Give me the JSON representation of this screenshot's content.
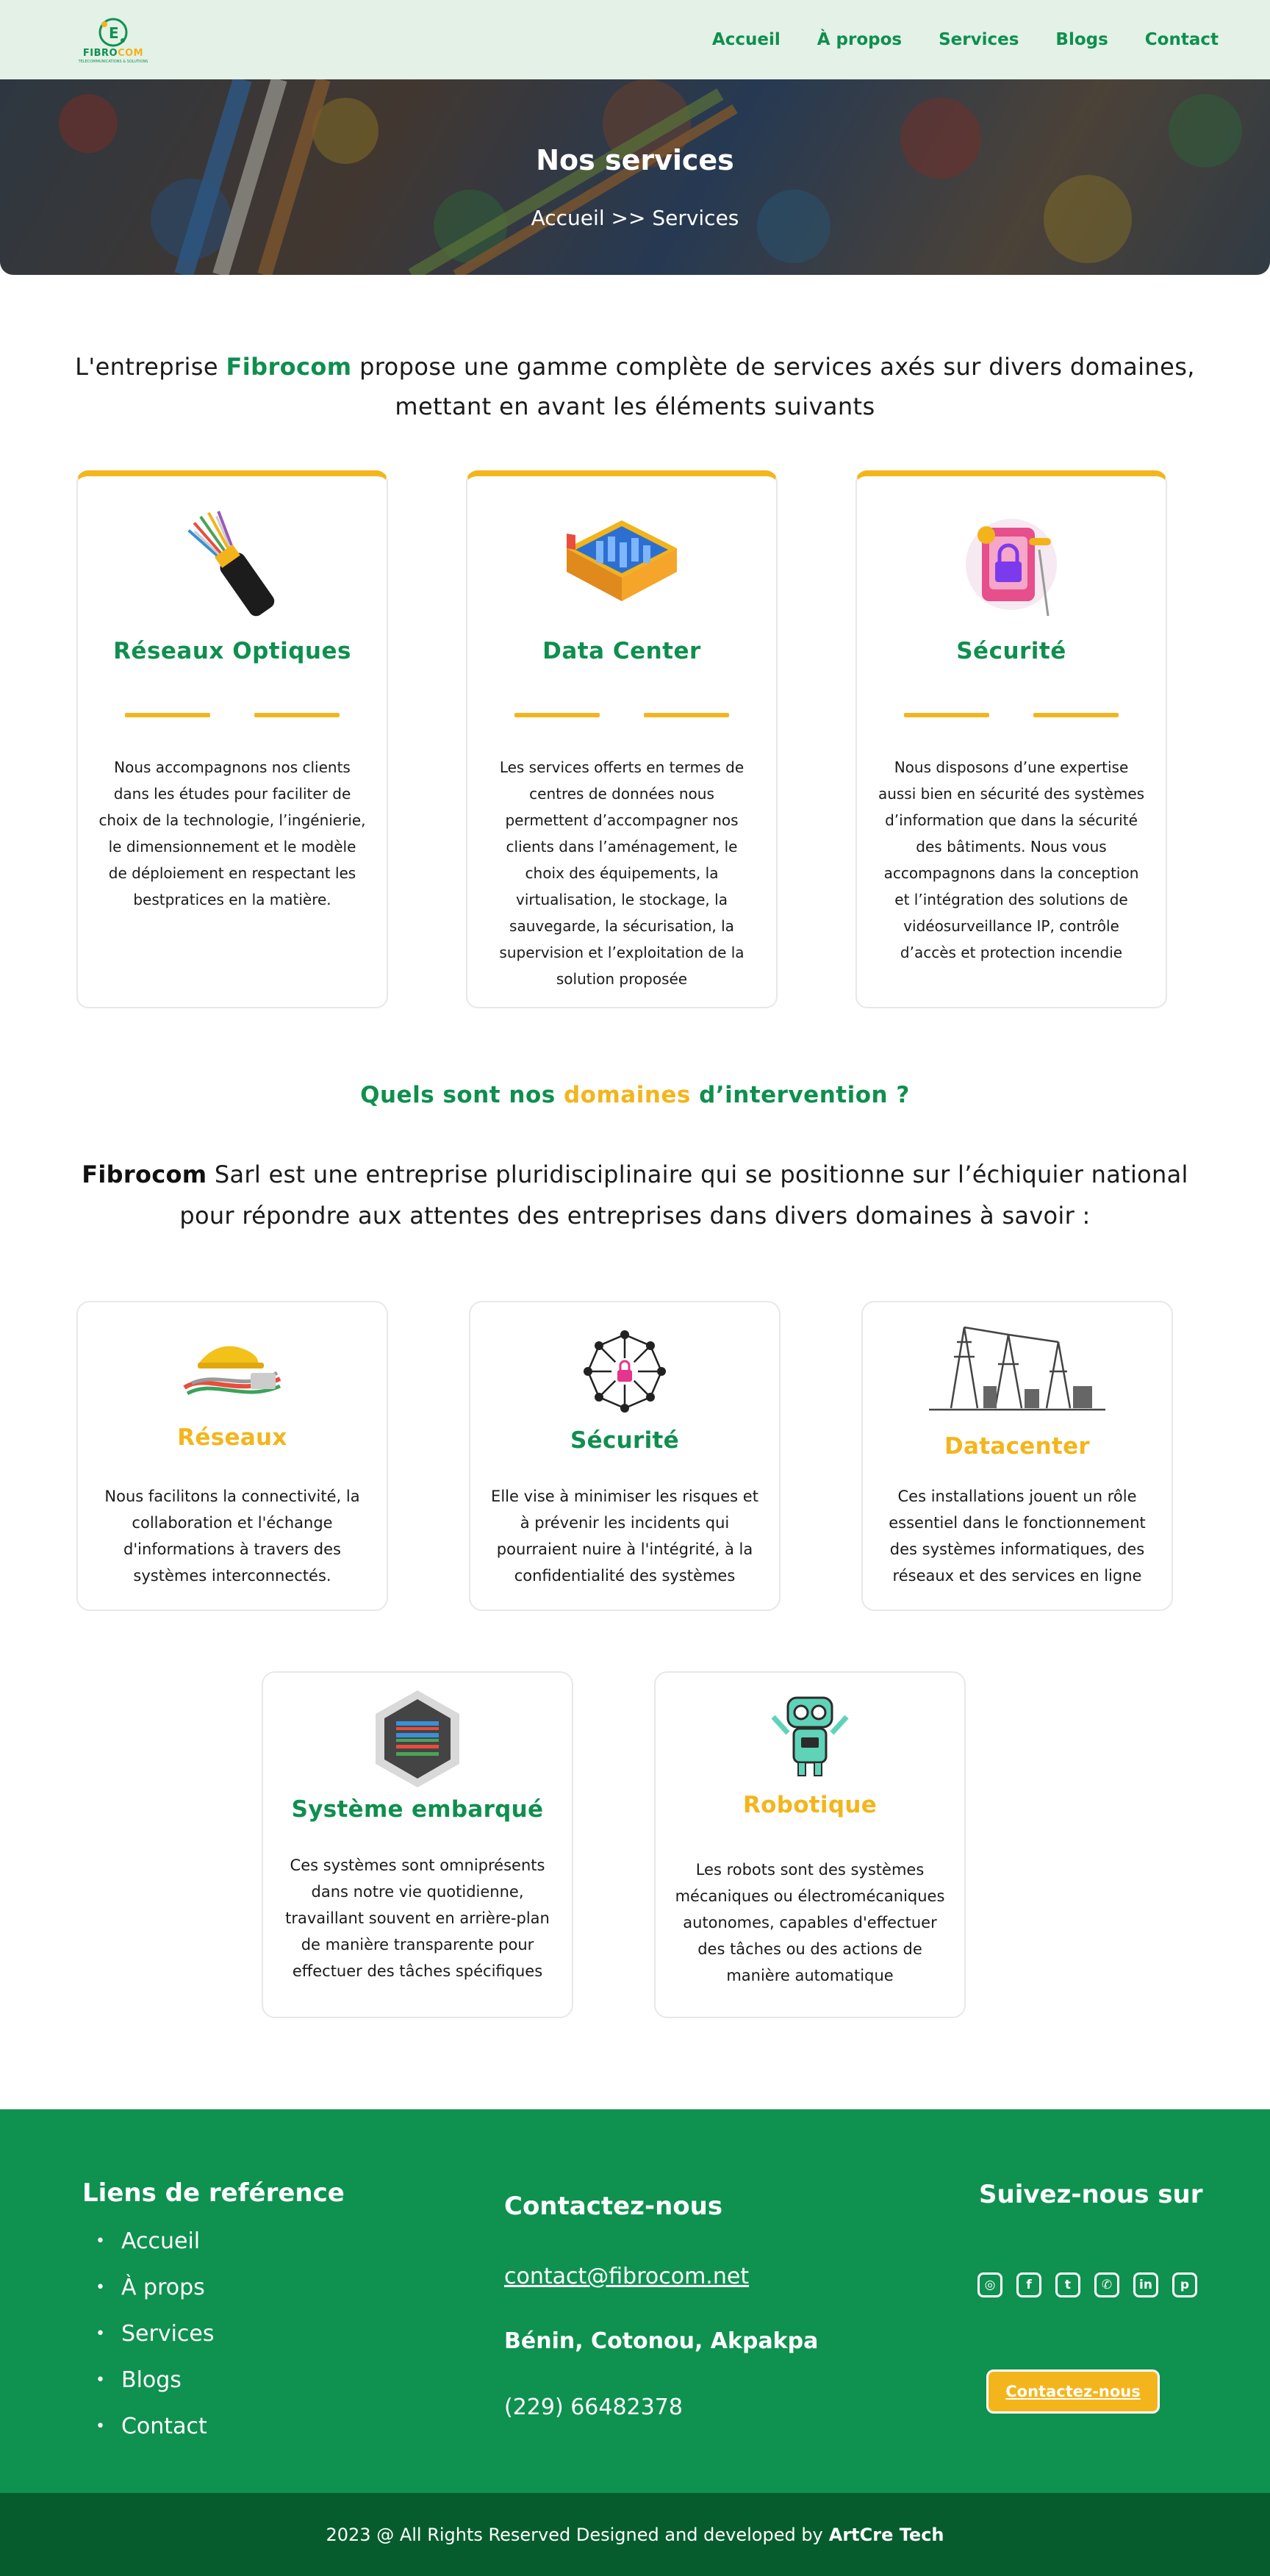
{
  "header": {
    "logo": {
      "name_part1": "FIBRO",
      "name_part2": "COM",
      "tagline": "TELECOMMUNICATIONS & SOLUTIONS"
    },
    "nav": [
      "Accueil",
      "À propos",
      "Services",
      "Blogs",
      "Contact"
    ]
  },
  "hero": {
    "title": "Nos services",
    "breadcrumb": "Accueil >> Services"
  },
  "intro": {
    "before": "L'entreprise ",
    "brand": "Fibrocom",
    "after": " propose une gamme complète de services axés sur divers domaines, mettant en avant les éléments suivants"
  },
  "services": [
    {
      "title": "Réseaux Optiques",
      "description": "Nous accompagnons nos clients dans les études pour faciliter de choix de la technologie, l’ingénierie, le dimensionnement et le modèle de déploiement en respectant les bestpratices en la matière."
    },
    {
      "title": "Data Center",
      "description": "Les services offerts en termes de centres de données nous permettent d’accompagner nos clients dans l’aménagement, le choix des équipements, la virtualisation, le stockage, la sauvegarde, la sécurisation, la supervision et l’exploitation de la solution proposée"
    },
    {
      "title": "Sécurité",
      "description": "Nous disposons d’une expertise aussi bien en sécurité des systèmes d’information que dans la sécurité des bâtiments. Nous vous accompagnons dans la conception et l’intégration des solutions de vidéosurveillance IP, contrôle d’accès et protection incendie"
    }
  ],
  "domains": {
    "title_part1": "Quels sont nos ",
    "title_part2": "domaines",
    "title_part3": " d’intervention ?",
    "intro_brand": "Fibrocom",
    "intro_text": " Sarl est une entreprise pluridisciplinaire qui se positionne sur l’échiquier national pour répondre aux attentes des entreprises dans divers domaines à savoir :",
    "items": [
      {
        "title": "Réseaux",
        "color": "#f4b51c",
        "description": "Nous facilitons la connectivité, la collaboration et l'échange d'informations à travers des systèmes interconnectés."
      },
      {
        "title": "Sécurité",
        "color": "#0f8f4e",
        "description": "Elle vise à minimiser les risques et à prévenir les incidents qui pourraient nuire à l'intégrité, à la confidentialité des systèmes"
      },
      {
        "title": "Datacenter",
        "color": "#f4b51c",
        "description": "Ces installations jouent un rôle essentiel dans le fonctionnement des systèmes informatiques, des réseaux et des services en ligne"
      },
      {
        "title": "Système embarqué",
        "color": "#0f8f4e",
        "description": "Ces systèmes sont omniprésents dans notre vie quotidienne, travaillant souvent en arrière-plan de manière transparente pour effectuer des tâches spécifiques"
      },
      {
        "title": "Robotique",
        "color": "#f4b51c",
        "description": "Les robots sont des systèmes mécaniques ou électromécaniques autonomes, capables d'effectuer des tâches ou des actions de manière automatique"
      }
    ]
  },
  "footer": {
    "links_title": "Liens de reférence",
    "links": [
      "Accueil",
      "À props",
      "Services",
      "Blogs",
      "Contact"
    ],
    "contact_title": "Contactez-nous",
    "email": "contact@fibrocom.net",
    "address": "Bénin, Cotonou, Akpakpa",
    "phone": "(229) 66482378",
    "social_title": "Suivez-nous sur",
    "social_icons": [
      "instagram-icon",
      "facebook-icon",
      "twitter-icon",
      "viber-icon",
      "linkedin-icon",
      "pinterest-icon"
    ],
    "cta": "Contactez-nous",
    "copyright": "2023 @ All Rights Reserved Designed and developed by",
    "developer": "ArtCre Tech"
  },
  "colors": {
    "green": "#0f8f4e",
    "yellow": "#f4b51c",
    "dark_green": "#075c2e",
    "header_bg": "#e3f1e7"
  }
}
